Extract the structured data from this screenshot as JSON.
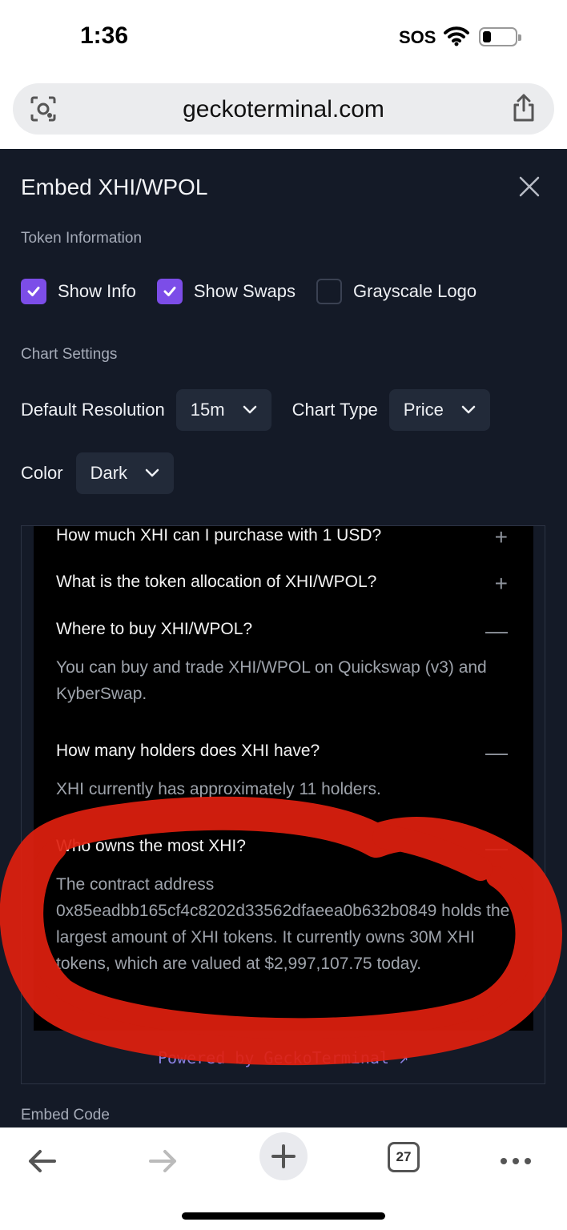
{
  "status_bar": {
    "time": "1:36",
    "sos": "SOS"
  },
  "browser": {
    "url": "geckoterminal.com",
    "tab_count": "27"
  },
  "modal": {
    "title": "Embed XHI/WPOL",
    "token_info_label": "Token Information",
    "checkboxes": [
      {
        "label": "Show Info",
        "checked": true
      },
      {
        "label": "Show Swaps",
        "checked": true
      },
      {
        "label": "Grayscale Logo",
        "checked": false
      }
    ],
    "chart_settings_label": "Chart Settings",
    "default_resolution_label": "Default Resolution",
    "default_resolution_value": "15m",
    "chart_type_label": "Chart Type",
    "chart_type_value": "Price",
    "color_label": "Color",
    "color_value": "Dark",
    "embed_code_label": "Embed Code"
  },
  "faq": {
    "items": [
      {
        "question": "How much XHI can I purchase with 1 USD?",
        "toggle": "+"
      },
      {
        "question": "What is the token allocation of XHI/WPOL?",
        "toggle": "+"
      },
      {
        "question": "Where to buy XHI/WPOL?",
        "toggle": "—",
        "answer": "You can buy and trade XHI/WPOL on Quickswap (v3) and KyberSwap."
      },
      {
        "question": "How many holders does XHI have?",
        "toggle": "—",
        "answer": "XHI currently has approximately 11 holders."
      },
      {
        "question": "Who owns the most XHI?",
        "toggle": "—",
        "answer": "The contract address 0x85eadbb165cf4c8202d33562dfaeea0b632b0849 holds the largest amount of XHI tokens. It currently owns 30M XHI tokens, which are valued at $2,997,107.75 today."
      }
    ],
    "powered_by": "Powered by GeckoTerminal ↗"
  },
  "colors": {
    "accent": "#7c4de8",
    "modal_bg": "#141a27",
    "scribble": "#e0200f"
  }
}
